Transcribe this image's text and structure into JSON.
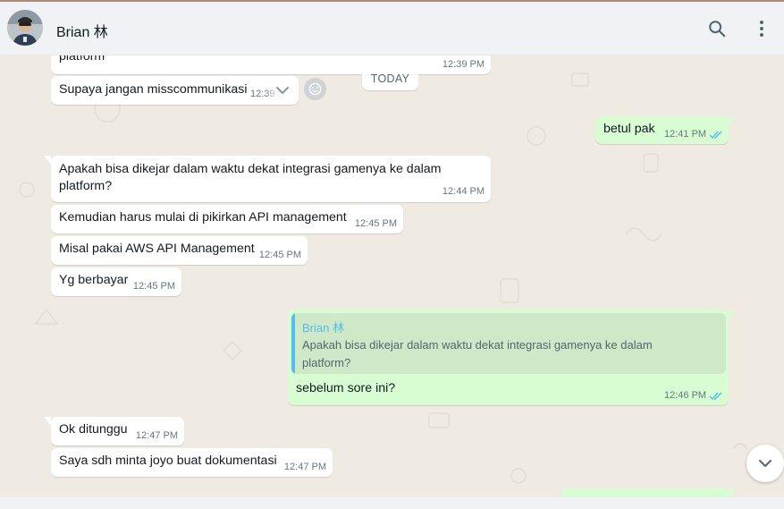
{
  "header": {
    "contact_name": "Brian 林",
    "avatar_icon": "person-avatar",
    "search_icon": "search-icon",
    "menu_icon": "more-vertical-icon"
  },
  "date_divider": "TODAY",
  "messages": [
    {
      "dir": "in",
      "text": "platform",
      "time": "12:39 PM"
    },
    {
      "dir": "in",
      "text": "Supaya jangan misscommunikasi",
      "time": "12:39 PM"
    },
    {
      "dir": "out",
      "text": "betul pak",
      "time": "12:41 PM",
      "status": "read"
    },
    {
      "dir": "in",
      "lines": [
        "Apakah bisa dikejar dalam waktu dekat integrasi gamenya ke dalam",
        "platform?"
      ],
      "time": "12:44 PM"
    },
    {
      "dir": "in",
      "text": "Kemudian harus mulai di pikirkan API management",
      "time": "12:45 PM"
    },
    {
      "dir": "in",
      "text": "Misal pakai AWS API Management",
      "time": "12:45 PM"
    },
    {
      "dir": "in",
      "text": "Yg berbayar",
      "time": "12:45 PM"
    },
    {
      "dir": "out",
      "quote": {
        "author": "Brian 林",
        "lines": [
          "Apakah bisa dikejar dalam waktu dekat integrasi gamenya ke dalam",
          "platform?"
        ]
      },
      "text": "sebelum sore ini?",
      "time": "12:46 PM",
      "status": "read"
    },
    {
      "dir": "in",
      "text": "Ok ditunggu",
      "time": "12:47 PM"
    },
    {
      "dir": "in",
      "text": "Saya sdh minta joyo buat dokumentasi",
      "time": "12:47 PM"
    },
    {
      "dir": "out",
      "text": "",
      "time": ""
    }
  ],
  "colors": {
    "incoming_bubble": "#ffffff",
    "outgoing_bubble": "#d9fdd3",
    "read_tick": "#53bdeb",
    "quote_author": "#53bdeb",
    "chat_background": "#efeae2"
  }
}
